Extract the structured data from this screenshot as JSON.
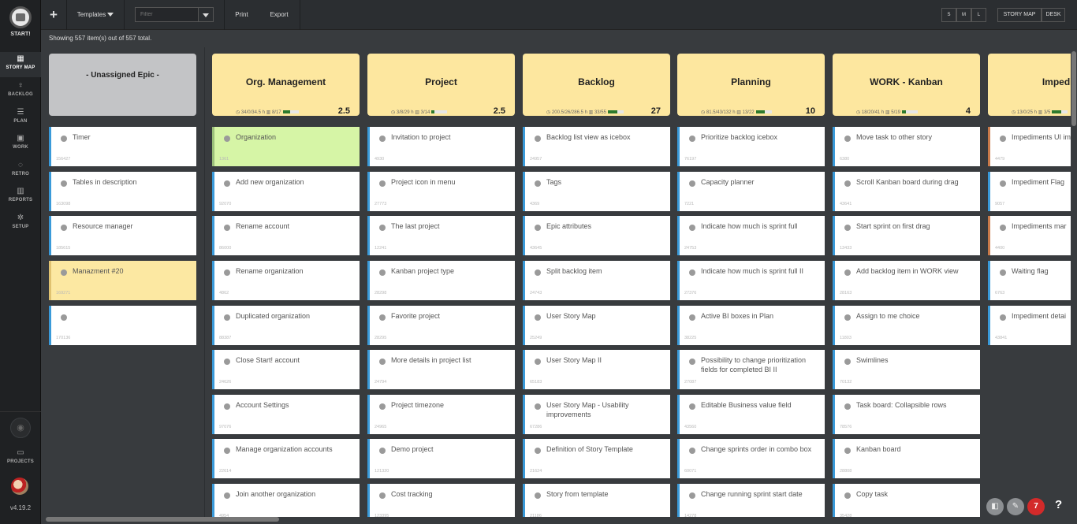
{
  "app": {
    "logo_label": "START!",
    "version": "v4.19.2"
  },
  "nav": [
    {
      "icon": "▦",
      "label": "STORY MAP"
    },
    {
      "icon": "♀",
      "label": "BACKLOG"
    },
    {
      "icon": "☰",
      "label": "PLAN"
    },
    {
      "icon": "▣",
      "label": "WORK"
    },
    {
      "icon": "◌",
      "label": "RETRO"
    },
    {
      "icon": "▥",
      "label": "REPORTS"
    },
    {
      "icon": "✲",
      "label": "SETUP"
    }
  ],
  "projects": {
    "icon": "▭",
    "label": "PROJECTS"
  },
  "toolbar": {
    "add": "+",
    "templates": "Templates",
    "filter_placeholder": "Filter",
    "print": "Print",
    "export": "Export",
    "sizes": [
      "S",
      "M",
      "L"
    ],
    "views": [
      "STORY MAP",
      "DESK"
    ]
  },
  "info": "Showing 557 item(s) out of 557 total.",
  "unassigned": {
    "title": "- Unassigned Epic -",
    "cards": [
      {
        "title": "Timer",
        "id": "156427",
        "color": "blue"
      },
      {
        "title": "Tables in description",
        "id": "163098",
        "color": "blue"
      },
      {
        "title": "Resource manager",
        "id": "185615",
        "color": "blue"
      },
      {
        "title": "Manazment #20",
        "id": "169271",
        "color": "yellow"
      },
      {
        "title": "",
        "id": "170136",
        "color": "blue"
      }
    ]
  },
  "epics": [
    {
      "title": "Org. Management",
      "stats": "34/0/34.5 h",
      "progress_text": "8/17",
      "progress": 0.47,
      "points": "2.5",
      "cards": [
        {
          "title": "Organization",
          "id": "1361",
          "color": "green"
        },
        {
          "title": "Add new organization",
          "id": "92070",
          "color": "blue"
        },
        {
          "title": "Rename account",
          "id": "86000",
          "color": "blue"
        },
        {
          "title": "Rename organization",
          "id": "4862",
          "color": "blue"
        },
        {
          "title": "Duplicated organization",
          "id": "88387",
          "color": "blue"
        },
        {
          "title": "Close Start! account",
          "id": "24626",
          "color": "blue"
        },
        {
          "title": "Account Settings",
          "id": "97076",
          "color": "blue"
        },
        {
          "title": "Manage organization accounts",
          "id": "22614",
          "color": "blue"
        },
        {
          "title": "Join another organization",
          "id": "4954",
          "color": "blue"
        }
      ]
    },
    {
      "title": "Project",
      "stats": "3/8/29 h",
      "progress_text": "3/14",
      "progress": 0.21,
      "points": "2.5",
      "cards": [
        {
          "title": "Invitation to project",
          "id": "4930",
          "color": "blue"
        },
        {
          "title": "Project icon in menu",
          "id": "27773",
          "color": "blue"
        },
        {
          "title": "The last project",
          "id": "12241",
          "color": "blue"
        },
        {
          "title": "Kanban project type",
          "id": "28298",
          "color": "blue"
        },
        {
          "title": "Favorite project",
          "id": "28295",
          "color": "blue"
        },
        {
          "title": "More details in project list",
          "id": "24794",
          "color": "blue"
        },
        {
          "title": "Project timezone",
          "id": "24965",
          "color": "blue"
        },
        {
          "title": "Demo project",
          "id": "121320",
          "color": "blue"
        },
        {
          "title": "Cost tracking",
          "id": "123395",
          "color": "blue"
        }
      ]
    },
    {
      "title": "Backlog",
      "stats": "200.5/26/286.5 h",
      "progress_text": "33/55",
      "progress": 0.6,
      "points": "27",
      "cards": [
        {
          "title": "Backlog list view as icebox",
          "id": "24957",
          "color": "blue"
        },
        {
          "title": "Tags",
          "id": "4369",
          "color": "blue"
        },
        {
          "title": "Epic attributes",
          "id": "43645",
          "color": "blue"
        },
        {
          "title": "Split backlog item",
          "id": "24743",
          "color": "blue"
        },
        {
          "title": "User Story Map",
          "id": "25249",
          "color": "blue"
        },
        {
          "title": "User Story Map II",
          "id": "65183",
          "color": "blue"
        },
        {
          "title": "User Story Map - Usability improvements",
          "id": "67286",
          "color": "blue"
        },
        {
          "title": "Definition of Story Template",
          "id": "21624",
          "color": "blue"
        },
        {
          "title": "Story from template",
          "id": "21186",
          "color": "blue"
        }
      ]
    },
    {
      "title": "Planning",
      "stats": "81.5/43/132 h",
      "progress_text": "13/22",
      "progress": 0.59,
      "points": "10",
      "cards": [
        {
          "title": "Prioritize backlog icebox",
          "id": "76197",
          "color": "blue"
        },
        {
          "title": "Capacity planner",
          "id": "7221",
          "color": "blue"
        },
        {
          "title": "Indicate how much is sprint full",
          "id": "24753",
          "color": "blue"
        },
        {
          "title": "Indicate how much is sprint full II",
          "id": "27376",
          "color": "blue"
        },
        {
          "title": "Active BI boxes in Plan",
          "id": "38225",
          "color": "blue"
        },
        {
          "title": "Possibility to change prioritization fields for completed BI II",
          "id": "27087",
          "color": "blue"
        },
        {
          "title": "Editable Business value field",
          "id": "43560",
          "color": "blue"
        },
        {
          "title": "Change sprints order in combo box",
          "id": "60071",
          "color": "blue"
        },
        {
          "title": "Change running sprint start date",
          "id": "14278",
          "color": "blue"
        }
      ]
    },
    {
      "title": "WORK - Kanban",
      "stats": "18/20/41 h",
      "progress_text": "5/19",
      "progress": 0.26,
      "points": "4",
      "cards": [
        {
          "title": "Move task to other story",
          "id": "6380",
          "color": "blue"
        },
        {
          "title": "Scroll Kanban board during drag",
          "id": "43641",
          "color": "blue"
        },
        {
          "title": "Start sprint on first drag",
          "id": "13433",
          "color": "blue"
        },
        {
          "title": "Add backlog item in WORK view",
          "id": "28163",
          "color": "blue"
        },
        {
          "title": "Assign to me choice",
          "id": "11803",
          "color": "blue"
        },
        {
          "title": "Swimlines",
          "id": "70132",
          "color": "blue"
        },
        {
          "title": "Task board: Collapsible rows",
          "id": "78576",
          "color": "blue"
        },
        {
          "title": "Kanban board",
          "id": "28808",
          "color": "blue"
        },
        {
          "title": "Copy task",
          "id": "35428",
          "color": "blue"
        }
      ]
    },
    {
      "title": "Impedim",
      "stats": "13/0/25 h",
      "progress_text": "3/5",
      "progress": 0.6,
      "points": "",
      "cards": [
        {
          "title": "Impediments UI improvements",
          "id": "4479",
          "color": "impediment"
        },
        {
          "title": "Impediment Flag",
          "id": "9057",
          "color": "blue"
        },
        {
          "title": "Impediments mar",
          "id": "4400",
          "color": "impediment"
        },
        {
          "title": "Waiting flag",
          "id": "6763",
          "color": "blue"
        },
        {
          "title": "Impediment detai",
          "id": "43841",
          "color": "blue"
        }
      ]
    }
  ],
  "floating": {
    "badge_count": "7",
    "help": "?"
  }
}
